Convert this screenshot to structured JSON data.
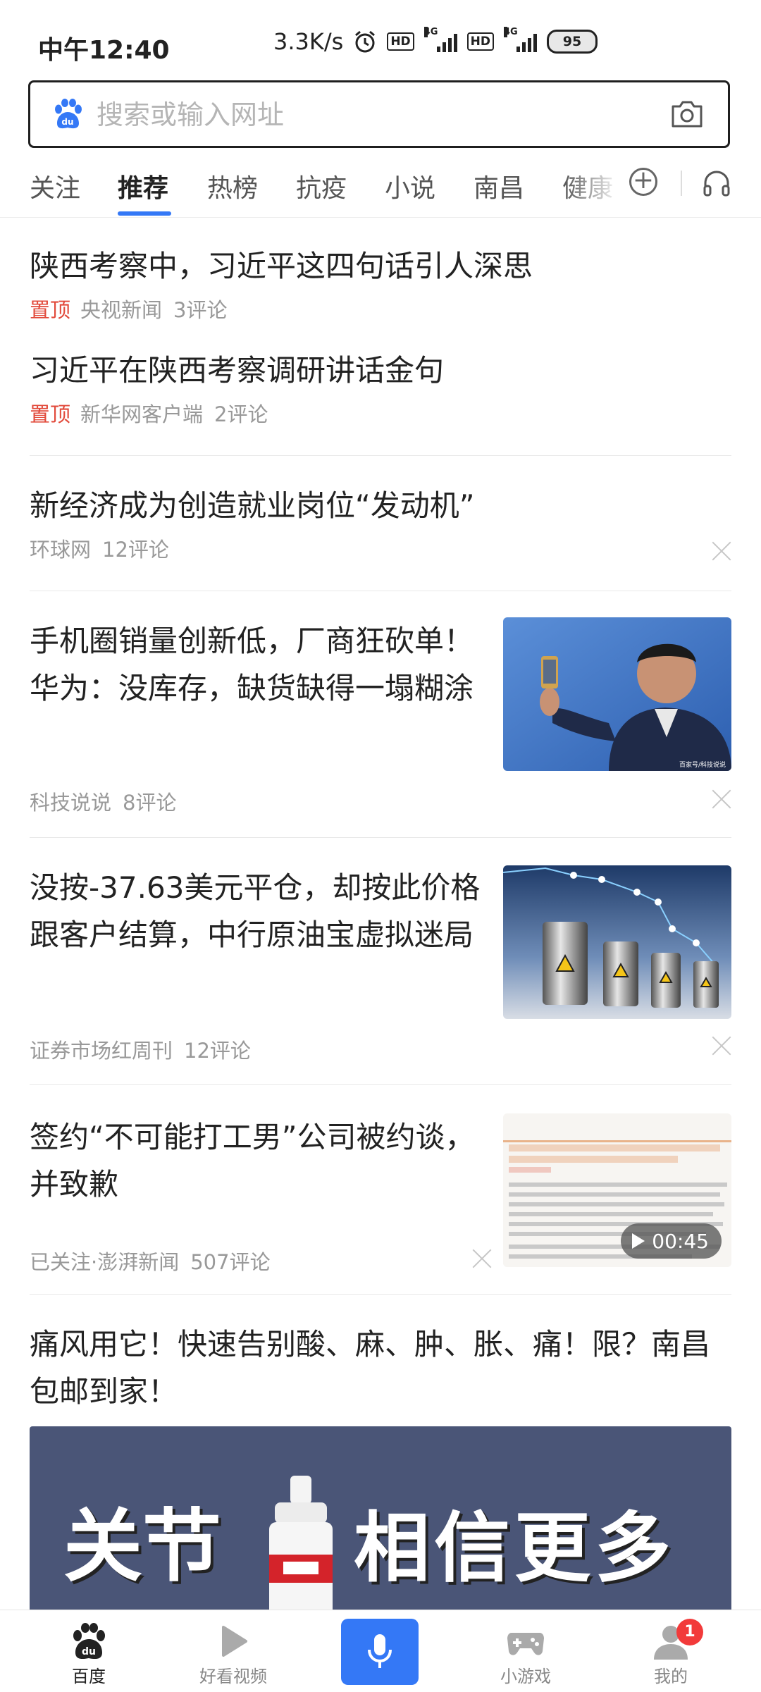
{
  "status_bar": {
    "time": "中午12:40",
    "net_speed": "3.3K/s",
    "hd1": "HD",
    "hd2": "HD",
    "net1": "4G",
    "net2": "4G",
    "battery": "95",
    "icons": [
      "alarm-icon",
      "signal-icon",
      "battery-icon"
    ]
  },
  "search": {
    "placeholder": "搜索或输入网址",
    "logo_icon": "baidu-paw-icon",
    "camera_icon": "camera-icon"
  },
  "tabs": [
    {
      "label": "关注",
      "active": false
    },
    {
      "label": "推荐",
      "active": true
    },
    {
      "label": "热榜",
      "active": false
    },
    {
      "label": "抗疫",
      "active": false
    },
    {
      "label": "小说",
      "active": false
    },
    {
      "label": "南昌",
      "active": false
    },
    {
      "label": "健康",
      "active": false
    }
  ],
  "feed": [
    {
      "title": "陕西考察中，习近平这四句话引人深思",
      "pin": "置顶",
      "source": "央视新闻",
      "comments": "3评论"
    },
    {
      "title": "习近平在陕西考察调研讲话金句",
      "pin": "置顶",
      "source": "新华网客户端",
      "comments": "2评论"
    },
    {
      "title": "新经济成为创造就业岗位“发动机”",
      "source": "环球网",
      "comments": "12评论"
    },
    {
      "title": "手机圈销量创新低，厂商狂砍单！华为：没库存，缺货缺得一塌糊涂",
      "source": "科技说说",
      "comments": "8评论",
      "thumb_caption": "百家号/科技说说"
    },
    {
      "title": "没按-37.63美元平仓，却按此价格跟客户结算，中行原油宝虚拟迷局",
      "source": "证券市场红周刊",
      "comments": "12评论"
    },
    {
      "title": "签约“不可能打工男”公司被约谈，并致歉",
      "source": "已关注·澎湃新闻",
      "comments": "507评论",
      "duration": "00:45"
    },
    {
      "title": "痛风用它！快速告别酸、麻、肿、胀、痛！限？南昌包邮到家！",
      "ad_text_1": "关节",
      "ad_text_2": "相信更多"
    }
  ],
  "bottom_nav": [
    {
      "label": "百度",
      "icon": "baidu-paw-icon",
      "active": true
    },
    {
      "label": "好看视频",
      "icon": "play-icon",
      "active": false
    },
    {
      "label": "",
      "icon": "microphone-icon",
      "active": false
    },
    {
      "label": "小游戏",
      "icon": "gamepad-icon",
      "active": false
    },
    {
      "label": "我的",
      "icon": "user-icon",
      "active": false,
      "badge": "1"
    }
  ],
  "colors": {
    "accent": "#3478f6",
    "pin": "#e24a3b",
    "badge": "#f23a3a"
  }
}
